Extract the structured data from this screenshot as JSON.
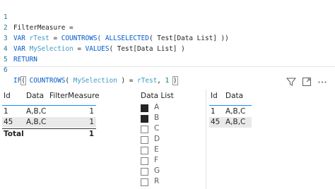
{
  "editor": {
    "lines": [
      {
        "num": "1",
        "text": "FilterMeasure ="
      },
      {
        "num": "2",
        "kw1": "VAR ",
        "var": "rTest",
        "eq": " = ",
        "kw2": "COUNTROWS( ",
        "kw3": "ALLSELECTED",
        "rest": "( Test[Data List] ))"
      },
      {
        "num": "3",
        "kw1": "VAR ",
        "var": "MySelection",
        "eq": " = ",
        "kw2": "VALUES",
        "rest": "( Test[Data List] )"
      },
      {
        "num": "4",
        "kw": "RETURN"
      },
      {
        "num": "5"
      },
      {
        "num": "6",
        "kw1": "IF",
        "p1": "(",
        "sp": " ",
        "kw2": "COUNTROWS",
        "mid": "( ",
        "var": "MySelection",
        "eq": " ) = ",
        "var2": "rTest",
        "comma": ", ",
        "one": "1",
        "sp2": " ",
        "p2": ")"
      }
    ]
  },
  "visual_header": {
    "filter_icon": "filter-icon",
    "focus_icon": "focus-mode-icon",
    "more_icon": "more-options-icon"
  },
  "table_left": {
    "headers": [
      "Id",
      "Data",
      "FilterMeasure"
    ],
    "rows": [
      {
        "id": "1",
        "data": "A,B,C",
        "measure": "1"
      },
      {
        "id": "45",
        "data": "A,B,C",
        "measure": "1"
      }
    ],
    "total": {
      "label": "Total",
      "measure": "1"
    }
  },
  "slicer": {
    "title": "Data List",
    "options": [
      {
        "label": "A",
        "checked": true
      },
      {
        "label": "B",
        "checked": true
      },
      {
        "label": "C",
        "checked": false
      },
      {
        "label": "D",
        "checked": false
      },
      {
        "label": "E",
        "checked": false
      },
      {
        "label": "F",
        "checked": false
      },
      {
        "label": "G",
        "checked": false
      },
      {
        "label": "R",
        "checked": false
      }
    ]
  },
  "table_right": {
    "headers": [
      "Id",
      "Data"
    ],
    "rows": [
      {
        "id": "1",
        "data": "A,B,C"
      },
      {
        "id": "45",
        "data": "A,B,C"
      }
    ]
  },
  "colors": {
    "keyword": "#035aca",
    "variable": "#3f9cc6",
    "line_number": "#237893",
    "header_underline": "#118dff",
    "row_highlight": "#e9e9e9"
  }
}
